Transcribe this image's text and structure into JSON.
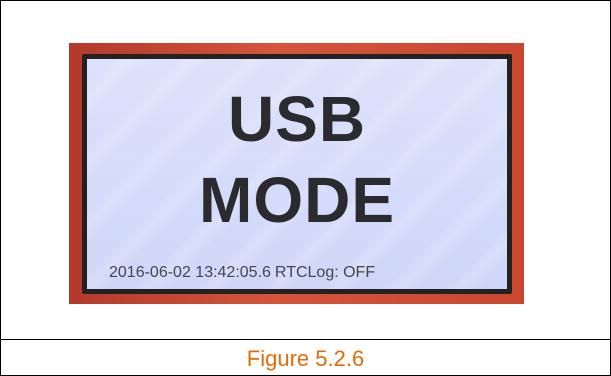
{
  "screen": {
    "mode_line1": "USB",
    "mode_line2": "MODE",
    "timestamp": "2016-06-02 13:42:05.6",
    "rtc_label": "RTC",
    "log_label": "Log: OFF"
  },
  "caption": {
    "text": "Figure 5.2.6"
  },
  "colors": {
    "caption": "#e36c0a",
    "screen_bg": "#d8defa",
    "device_body": "#c4432d",
    "bezel": "#242220"
  }
}
